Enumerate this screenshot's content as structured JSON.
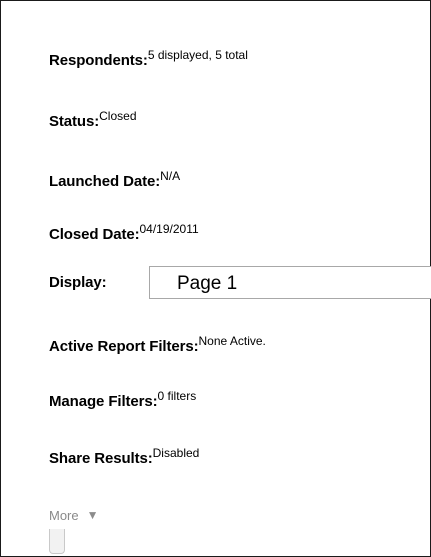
{
  "fields": {
    "respondents": {
      "label": "Respondents:",
      "value": "5 displayed, 5 total"
    },
    "status": {
      "label": "Status:",
      "value": "Closed"
    },
    "launched_date": {
      "label": "Launched Date:",
      "value": "N/A"
    },
    "closed_date": {
      "label": "Closed Date:",
      "value": "04/19/2011"
    },
    "display": {
      "label": "Display:",
      "selected": "Page 1"
    },
    "active_report_filters": {
      "label": "Active Report Filters:",
      "value": "None Active."
    },
    "manage_filters": {
      "label": "Manage Filters:",
      "value": "0 filters"
    },
    "share_results": {
      "label": "Share Results:",
      "value": "Disabled"
    }
  },
  "more": {
    "label": "More",
    "icon": "triangle-down-icon"
  }
}
